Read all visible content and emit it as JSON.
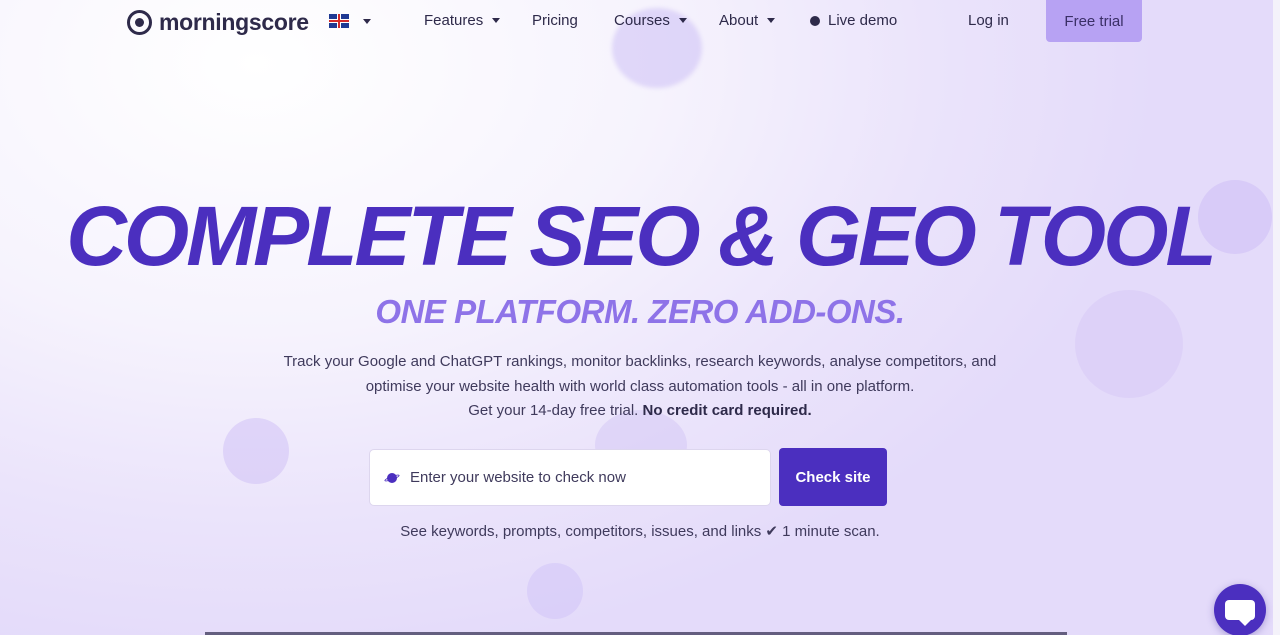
{
  "brand": {
    "name": "morningscore"
  },
  "nav": {
    "language": "EN",
    "items": [
      {
        "label": "Features",
        "has_dropdown": true
      },
      {
        "label": "Pricing",
        "has_dropdown": false
      },
      {
        "label": "Courses",
        "has_dropdown": true
      },
      {
        "label": "About",
        "has_dropdown": true
      },
      {
        "label": "Live demo",
        "has_dropdown": false
      }
    ],
    "login": "Log in",
    "cta": "Free trial"
  },
  "hero": {
    "title": "COMPLETE SEO & GEO TOOL",
    "subtitle": "ONE PLATFORM. ZERO ADD-ONS.",
    "description_line1": "Track your Google and ChatGPT rankings, monitor backlinks, research keywords, analyse competitors, and",
    "description_line2": "optimise your website health with world class automation tools - all in one platform.",
    "description_line3": "Get your 14-day free trial.",
    "description_bold": "No credit card required.",
    "search_placeholder": "Enter your website to check now",
    "check_button": "Check site",
    "scan_note": "See keywords, prompts, competitors, issues, and links ✔ 1 minute scan."
  },
  "colors": {
    "primary": "#4b2fbf",
    "cta_background": "#b7a2f3",
    "subtitle": "#8e73e8",
    "text": "#2e2a4a"
  },
  "icons": {
    "logo": "morningscore-logo-icon",
    "language": "uk-flag-icon",
    "search": "planet-icon",
    "chat": "chat-icon"
  }
}
